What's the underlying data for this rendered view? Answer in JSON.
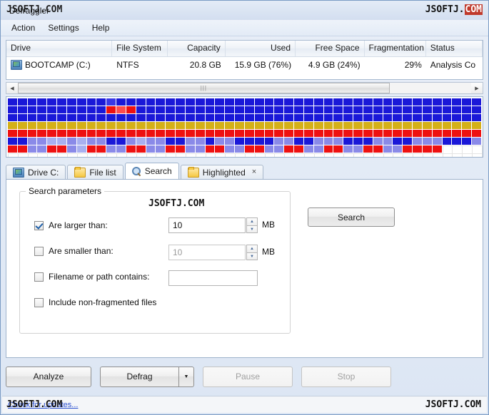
{
  "window": {
    "title": "Defraggler",
    "watermark_left": "JSOFTJ.COM",
    "watermark_right_prefix": "JSOFTJ.",
    "watermark_right_suffix": "COM",
    "watermark_colors": {
      "highlight_bg": "#c0392b",
      "highlight_fg": "#ffffff"
    }
  },
  "menubar": {
    "items": [
      {
        "label": "Action"
      },
      {
        "label": "Settings"
      },
      {
        "label": "Help"
      }
    ]
  },
  "drive_list": {
    "columns": [
      {
        "label": "Drive"
      },
      {
        "label": "File System"
      },
      {
        "label": "Capacity"
      },
      {
        "label": "Used"
      },
      {
        "label": "Free Space"
      },
      {
        "label": "Fragmentation"
      },
      {
        "label": "Status"
      }
    ],
    "rows": [
      {
        "drive": "BOOTCAMP (C:)",
        "file_system": "NTFS",
        "capacity": "20.8 GB",
        "used": "15.9 GB (76%)",
        "free_space": "4.9 GB (24%)",
        "fragmentation": "29%",
        "status": "Analysis Co"
      }
    ]
  },
  "scrollbar": {
    "left_arrow": "◀",
    "right_arrow": "▶",
    "grip": "|||"
  },
  "drive_map": {
    "legend_colors": {
      "fragmented": "#ee1111",
      "used": "#1a18d8",
      "mft": "#d4b018",
      "highlighted": "#8a8ae8",
      "free": "#ffffff"
    },
    "columns": 48,
    "rows": [
      "bbbbbbbbbbBbbbbbbbbbbbbbbbbbbbbbbbbbbbbbbbbbbbbb",
      "bbbbbbbbbbrRrbbbbbbbbbbbbbbbbbbbbbbbbbbbbbbbbbbb",
      "bbbbbbbbbbbbbbbbbbbbbbbbbbbbbbbbbbbbbbbbbbbbbbbb",
      "yyyyyyyyyyyyyyyyyyyyyyyyyyyyyyyyyyyyyyyyyyyyyyyy",
      "rrrrrrrrrrrrrrrrrrrrrrrrrrrrrrrrrrrrrrrrrrrrrrrr",
      "bbhhHHhHhhbbhHhhbbhhbhhbbbbhhbbhhhbbbhhbbhhhbbbh",
      "rrhhrrhHrrhhrrhhrrhhrrhhrrhhrrhhrrhhrrhhrrrr....",
      "................................................"
    ]
  },
  "tabs": [
    {
      "label": "Drive C:",
      "icon": "drive-icon",
      "active": false,
      "closable": false
    },
    {
      "label": "File list",
      "icon": "folder-icon",
      "active": false,
      "closable": false
    },
    {
      "label": "Search",
      "icon": "search-icon",
      "active": true,
      "closable": false
    },
    {
      "label": "Highlighted",
      "icon": "folder-icon",
      "active": false,
      "closable": true,
      "close_glyph": "×"
    }
  ],
  "search_panel": {
    "group_title": "Search parameters",
    "watermark": "JSOFTJ.COM",
    "larger_than": {
      "label": "Are larger than:",
      "checked": true,
      "value": "10",
      "unit": "MB"
    },
    "smaller_than": {
      "label": "Are smaller than:",
      "checked": false,
      "value": "10",
      "unit": "MB"
    },
    "filename_contains": {
      "label": "Filename or path contains:",
      "checked": false,
      "value": "",
      "placeholder": ""
    },
    "include_non_fragmented": {
      "label": "Include non-fragmented files",
      "checked": false
    },
    "search_button": "Search"
  },
  "bottom_buttons": {
    "analyze": {
      "label": "Analyze",
      "enabled": true
    },
    "defrag": {
      "label": "Defrag",
      "enabled": true,
      "arrow": "▼"
    },
    "pause": {
      "label": "Pause",
      "enabled": false
    },
    "stop": {
      "label": "Stop",
      "enabled": false
    }
  },
  "statusbar": {
    "link": "Check for updates...",
    "watermark_left": "JSOFTJ.COM",
    "watermark_right": "JSOFTJ.COM"
  }
}
